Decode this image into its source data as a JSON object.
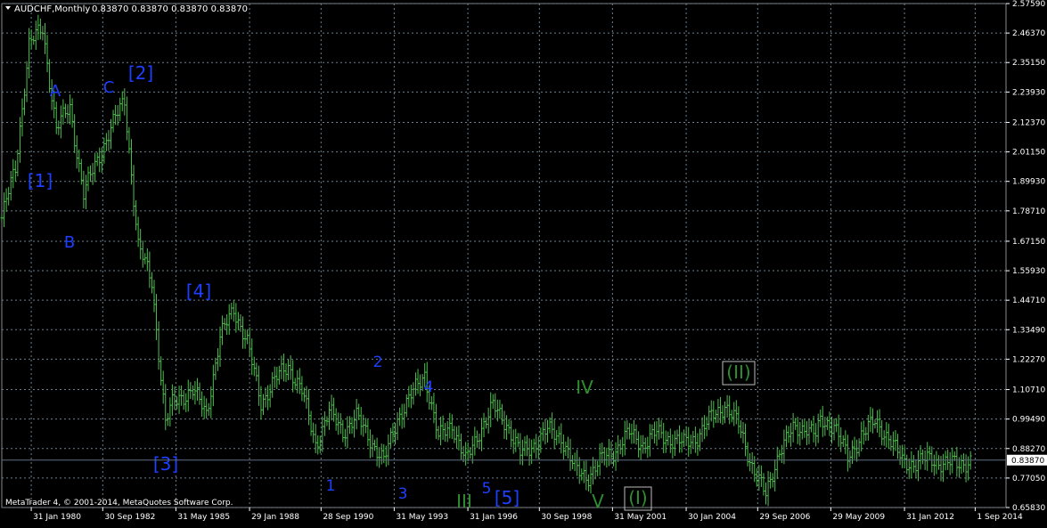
{
  "header": {
    "symbol": "AUDCHF,Monthly",
    "ohlc": "0.83870 0.83870 0.83870 0.83870"
  },
  "copyright": "MetaTrader 4, © 2001-2014, MetaQuotes Software Corp.",
  "colors": {
    "background": "#000000",
    "grid": "#6b7f8e",
    "axis_text": "#ffffff",
    "bars": "#4fbf4f",
    "wave_blue": "#1f3fff",
    "wave_green": "#2f8f2f",
    "price_line": "#5f6f7f"
  },
  "chart_data": {
    "type": "ohlc-bar",
    "title": "AUDCHF,Monthly",
    "y_ticks": [
      "2.57590",
      "2.46370",
      "2.35150",
      "2.23930",
      "2.12370",
      "2.01150",
      "1.89930",
      "1.78710",
      "1.67150",
      "1.55930",
      "1.44710",
      "1.33490",
      "1.22270",
      "1.10710",
      "0.99490",
      "0.88270",
      "0.77050",
      "0.65830"
    ],
    "ylim": [
      0.6583,
      2.5759
    ],
    "x_ticks": [
      "31 Jan 1980",
      "30 Sep 1982",
      "31 May 1985",
      "29 Jan 1988",
      "28 Sep 1990",
      "31 May 1993",
      "31 Jan 1996",
      "30 Sep 1998",
      "31 May 2001",
      "30 Jan 2004",
      "29 Sep 2006",
      "29 May 2009",
      "31 Jan 2012",
      "1 Sep 2014"
    ],
    "current_price": "0.83870",
    "series": [
      {
        "x": [
          "1979-01",
          "1979-07",
          "1980-01",
          "1980-07",
          "1981-01",
          "1981-07",
          "1982-01",
          "1982-07",
          "1983-01",
          "1983-07",
          "1984-01",
          "1984-07",
          "1985-01",
          "1985-04",
          "1985-07",
          "1986-01",
          "1986-07",
          "1987-01",
          "1987-07",
          "1988-01",
          "1988-07",
          "1989-01",
          "1989-07",
          "1990-01",
          "1990-07",
          "1991-01",
          "1991-07",
          "1992-01",
          "1992-07",
          "1993-01",
          "1993-07",
          "1994-01",
          "1994-07",
          "1995-01",
          "1995-07",
          "1996-01",
          "1996-07",
          "1997-01",
          "1997-07",
          "1998-01",
          "1998-07",
          "1999-01",
          "1999-07",
          "2000-01",
          "2000-07",
          "2001-01",
          "2001-07",
          "2002-01",
          "2002-07",
          "2003-01",
          "2003-07",
          "2004-01",
          "2004-07",
          "2005-01",
          "2005-07",
          "2006-01",
          "2006-07",
          "2007-01",
          "2007-07",
          "2008-01",
          "2008-07",
          "2008-11",
          "2009-01",
          "2009-07",
          "2010-01",
          "2010-07",
          "2011-01",
          "2011-07",
          "2012-01",
          "2012-07",
          "2013-01",
          "2013-07",
          "2014-01",
          "2014-07"
        ],
        "y": [
          1.76,
          1.95,
          2.42,
          2.48,
          2.1,
          2.18,
          1.85,
          1.98,
          2.1,
          2.21,
          1.65,
          1.52,
          0.98,
          1.05,
          1.08,
          1.1,
          1.02,
          1.3,
          1.42,
          1.28,
          1.06,
          1.14,
          1.2,
          1.1,
          0.9,
          1.02,
          0.95,
          1.0,
          0.92,
          0.83,
          1.0,
          1.08,
          1.17,
          0.92,
          0.98,
          0.83,
          0.95,
          1.04,
          0.98,
          0.86,
          0.9,
          0.95,
          0.93,
          0.8,
          0.78,
          0.84,
          0.88,
          0.94,
          0.9,
          0.94,
          0.92,
          0.9,
          0.93,
          1.0,
          1.05,
          0.97,
          0.82,
          0.7,
          0.88,
          0.95,
          0.97,
          0.93,
          0.98,
          0.98,
          0.84,
          0.94,
          0.98,
          0.93,
          0.83,
          0.83,
          0.84,
          0.83,
          0.82,
          0.84
        ]
      }
    ],
    "wave_labels": [
      {
        "text": "A",
        "color": "blue"
      },
      {
        "text": "C",
        "color": "blue"
      },
      {
        "text": "[2]",
        "color": "blue"
      },
      {
        "text": "[1]",
        "color": "blue"
      },
      {
        "text": "B",
        "color": "blue"
      },
      {
        "text": "[4]",
        "color": "blue"
      },
      {
        "text": "[3]",
        "color": "blue"
      },
      {
        "text": "2",
        "color": "blue"
      },
      {
        "text": "4",
        "color": "blue"
      },
      {
        "text": "1",
        "color": "blue"
      },
      {
        "text": "3",
        "color": "blue"
      },
      {
        "text": "5",
        "color": "blue"
      },
      {
        "text": "[5]",
        "color": "blue"
      },
      {
        "text": "III",
        "color": "green"
      },
      {
        "text": "IV",
        "color": "green"
      },
      {
        "text": "V",
        "color": "green"
      },
      {
        "text": "(I)",
        "color": "green"
      },
      {
        "text": "(II)",
        "color": "green"
      }
    ]
  }
}
